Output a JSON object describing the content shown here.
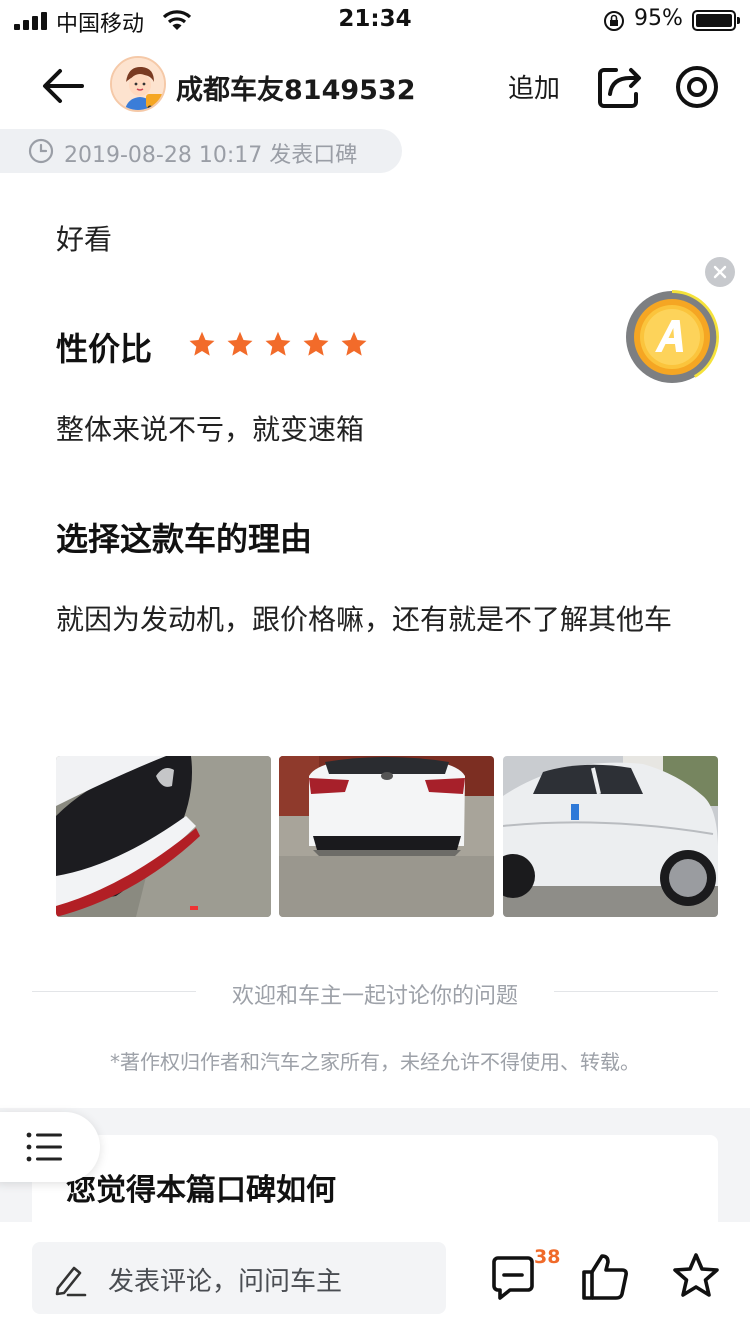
{
  "status_bar": {
    "carrier": "中国移动",
    "time": "21:34",
    "battery_percent": "95%"
  },
  "nav": {
    "author_name": "成都车友8149532",
    "append_label": "追加"
  },
  "post": {
    "timestamp_label": "2019-08-28 10:17 发表口碑",
    "intro_text": "好看",
    "value_section": {
      "title": "性价比",
      "rating": 5,
      "max_rating": 5,
      "body": "整体来说不亏，就变速箱"
    },
    "reason_section": {
      "title": "选择这款车的理由",
      "body": "就因为发动机，跟价格嘛，还有就是不了解其他车"
    },
    "photos": [
      "car-front-detail",
      "car-rear",
      "car-side"
    ]
  },
  "footer": {
    "discuss_prompt": "欢迎和车主一起讨论你的问题",
    "copyright": "*著作权归作者和汽车之家所有，未经允许不得使用、转载。",
    "feedback_title": "您觉得本篇口碑如何"
  },
  "bottom_bar": {
    "comment_placeholder": "发表评论，问问车主",
    "comment_count": "38"
  },
  "colors": {
    "star": "#f26b2a",
    "comment_count": "#f06a2a",
    "coin_gold": "#f5b82e"
  }
}
